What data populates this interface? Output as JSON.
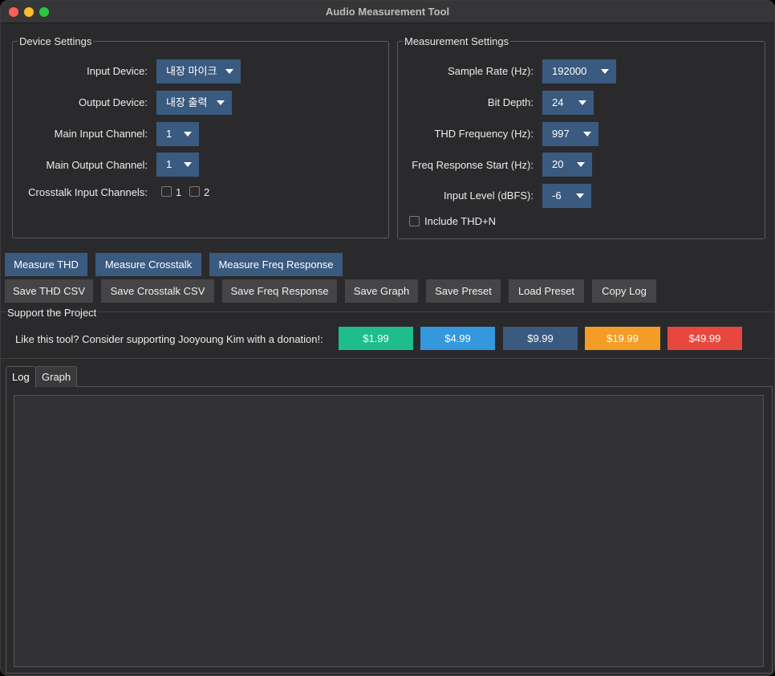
{
  "window": {
    "title": "Audio Measurement Tool"
  },
  "device_settings": {
    "title": "Device Settings",
    "input_device": {
      "label": "Input Device:",
      "value": "내장 마이크"
    },
    "output_device": {
      "label": "Output Device:",
      "value": "내장 출력"
    },
    "main_input_channel": {
      "label": "Main Input Channel:",
      "value": "1"
    },
    "main_output_channel": {
      "label": "Main Output Channel:",
      "value": "1"
    },
    "crosstalk": {
      "label": "Crosstalk Input Channels:",
      "channels": [
        "1",
        "2"
      ]
    }
  },
  "measurement_settings": {
    "title": "Measurement Settings",
    "sample_rate": {
      "label": "Sample Rate (Hz):",
      "value": "192000"
    },
    "bit_depth": {
      "label": "Bit Depth:",
      "value": "24"
    },
    "thd_frequency": {
      "label": "THD Frequency (Hz):",
      "value": "997"
    },
    "freq_start": {
      "label": "Freq Response Start (Hz):",
      "value": "20"
    },
    "input_level": {
      "label": "Input Level (dBFS):",
      "value": "-6"
    },
    "include_thdn": {
      "label": "Include THD+N",
      "checked": false
    }
  },
  "actions": {
    "measure_thd": "Measure THD",
    "measure_crosstalk": "Measure Crosstalk",
    "measure_freq": "Measure Freq Response",
    "save_thd_csv": "Save THD CSV",
    "save_crosstalk_csv": "Save Crosstalk CSV",
    "save_freq_response": "Save Freq Response",
    "save_graph": "Save Graph",
    "save_preset": "Save Preset",
    "load_preset": "Load Preset",
    "copy_log": "Copy Log"
  },
  "support": {
    "title": "Support the Project",
    "message": "Like this tool? Consider supporting Jooyoung Kim with a donation!:",
    "donations": [
      {
        "label": "$1.99",
        "color": "#1fbc8c"
      },
      {
        "label": "$4.99",
        "color": "#3598dc"
      },
      {
        "label": "$9.99",
        "color": "#3a5a80"
      },
      {
        "label": "$19.99",
        "color": "#f39c26"
      },
      {
        "label": "$49.99",
        "color": "#e8473f"
      }
    ]
  },
  "tabs": [
    {
      "label": "Log",
      "active": true
    },
    {
      "label": "Graph",
      "active": false
    }
  ],
  "log_text": ""
}
